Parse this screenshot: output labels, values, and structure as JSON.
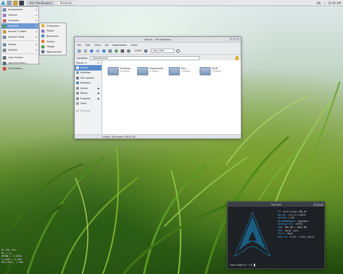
{
  "panel": {
    "tasks": [
      "Ext: File Browser",
      "Terminal"
    ],
    "tray": {
      "keyboard": "EN",
      "time": "11:00 AM"
    }
  },
  "start_menu": {
    "items": [
      {
        "label": "Accessories",
        "icon": "accessories-icon",
        "color": "#6b8fb5",
        "submenu": true
      },
      {
        "label": "Games",
        "icon": "games-icon",
        "color": "#9b7bb8",
        "submenu": true
      },
      {
        "label": "Graphics",
        "icon": "graphics-icon",
        "color": "#c96a6a",
        "submenu": true
      },
      {
        "label": "Internet",
        "icon": "internet-icon",
        "color": "#4f9a5d",
        "submenu": true,
        "highlighted": true
      },
      {
        "label": "Sound & Video",
        "icon": "sound-video-icon",
        "color": "#c99a3d",
        "submenu": true
      },
      {
        "label": "System Tools",
        "icon": "system-tools-icon",
        "color": "#7b8790",
        "submenu": true
      },
      {
        "label": "Places",
        "icon": "places-icon",
        "color": "#6b8fb5",
        "submenu": true
      },
      {
        "label": "System",
        "icon": "system-icon",
        "color": "#7b8790",
        "submenu": true
      },
      {
        "label": "Lock Screen",
        "icon": "lock-icon",
        "color": "#5f6b75",
        "submenu": false
      },
      {
        "label": "Log Out henri...",
        "icon": "logout-icon",
        "color": "#5f6b75",
        "submenu": false
      },
      {
        "label": "Shut Down...",
        "icon": "shutdown-icon",
        "color": "#d04a3c",
        "submenu": false
      }
    ]
  },
  "internet_submenu": {
    "items": [
      {
        "label": "Chromium",
        "icon": "chromium-icon",
        "color": "#e0b23a"
      },
      {
        "label": "Pidgin",
        "icon": "pidgin-icon",
        "color": "#8a6fc2"
      },
      {
        "label": "Remmina",
        "icon": "remmina-icon",
        "color": "#4a8fd4"
      },
      {
        "label": "Firefox",
        "icon": "firefox-icon",
        "color": "#e0782f"
      },
      {
        "label": "Hexgp",
        "icon": "hexchat-icon",
        "color": "#4d9a48"
      },
      {
        "label": "Webcamoid",
        "icon": "webcam-icon",
        "color": "#5c6f86"
      }
    ]
  },
  "file_manager": {
    "title": "henrik - File Browser",
    "menubar": [
      "File",
      "Edit",
      "View",
      "Go",
      "Bookmarks",
      "Help"
    ],
    "zoom": "100%",
    "view_mode": "Icon View",
    "location_label": "Location:",
    "location": "/home/henrik",
    "places_label": "Places",
    "sidebar": [
      {
        "label": "henrik",
        "icon": "home-icon",
        "selected": true,
        "eject": false
      },
      {
        "label": "Desktop",
        "icon": "desktop-icon",
        "selected": false,
        "eject": false
      },
      {
        "label": "File System",
        "icon": "filesystem-icon",
        "selected": false,
        "eject": false
      },
      {
        "label": "Network",
        "icon": "network-icon",
        "selected": false,
        "eject": false
      },
      {
        "label": "Serein",
        "icon": "drive-icon",
        "selected": false,
        "eject": true
      },
      {
        "label": "Movie",
        "icon": "drive-icon",
        "selected": false,
        "eject": true
      },
      {
        "label": "Program",
        "icon": "drive-icon",
        "selected": false,
        "eject": true
      },
      {
        "label": "Trash",
        "icon": "trash-icon",
        "selected": false,
        "eject": false
      }
    ],
    "sidebar_extra": "Pictures",
    "folders": [
      {
        "name": "Desktop",
        "count": "0 items"
      },
      {
        "name": "Downloads",
        "count": "3 items"
      },
      {
        "name": "Pics",
        "count": "1 items"
      },
      {
        "name": "Stuff",
        "count": "3 items"
      }
    ],
    "status": "4 items, Free space: 381.8 GB"
  },
  "terminal": {
    "title": "Terminal",
    "info": [
      {
        "k": "OS:",
        "v": "Arch Linux x86_64"
      },
      {
        "k": "Kernel:",
        "v": "3.5.3-1-ARCH"
      },
      {
        "k": "Uptime:",
        "v": "1:05"
      },
      {
        "k": "WindowManager:",
        "v": "Openbox"
      },
      {
        "k": "Desktop Env:",
        "v": "XFCE4"
      },
      {
        "k": "RAM:",
        "v": "495 MB / 3964 MB"
      },
      {
        "k": "CPU:",
        "v": "Intel Core"
      },
      {
        "k": "Shell:",
        "v": "Bash"
      },
      {
        "k": "Root FS:",
        "v": "8.4G / 9.0G (ext4)"
      }
    ],
    "prompt": "[henrik@arch ~]$"
  },
  "conky": {
    "lines": [
      "Oh 29m 54s",
      "9% / 1%",
      "495MB / 3.87GB",
      "3.43GB / 9.0GB",
      "291.3GB / 1.5GB"
    ]
  },
  "colors": {
    "accent": "#5a8ccc",
    "arch_blue": "#1793d1"
  }
}
